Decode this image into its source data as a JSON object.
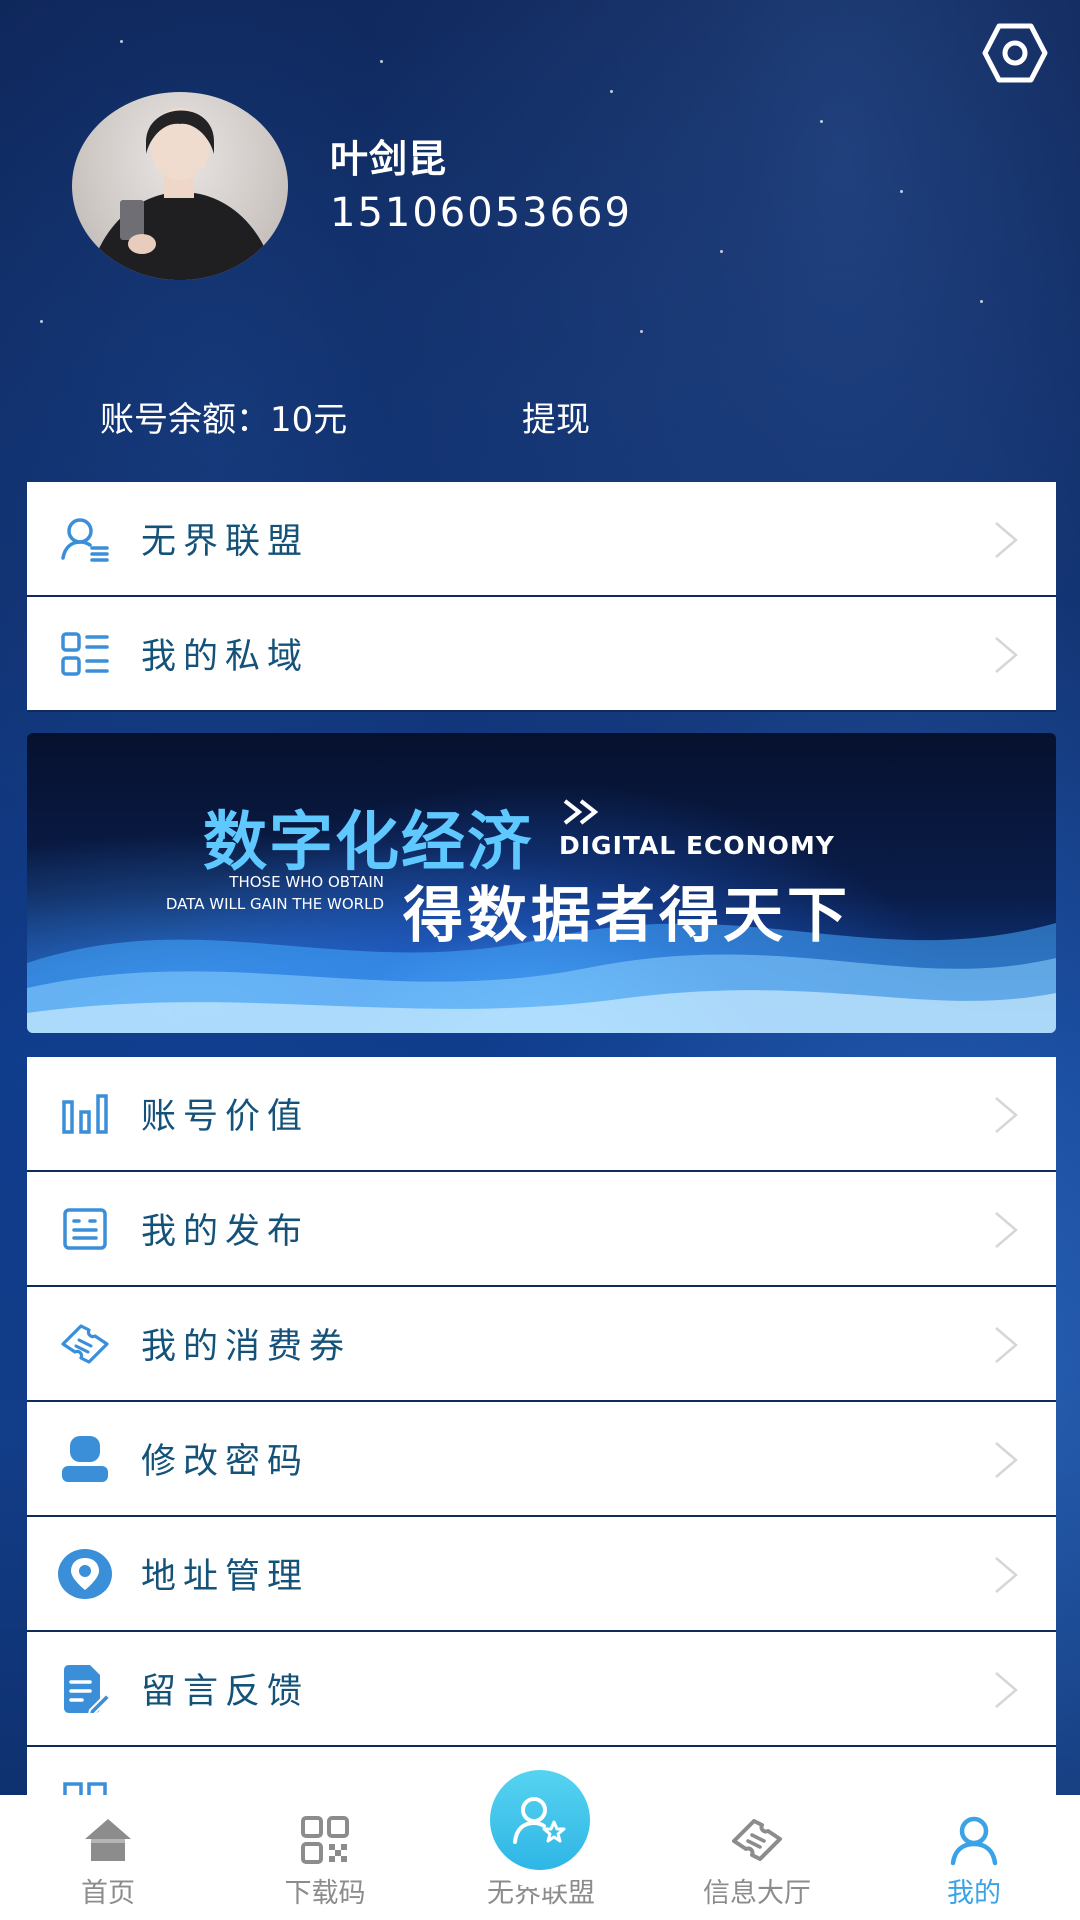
{
  "profile": {
    "name": "叶剑昆",
    "phone": "15106053669",
    "balance_text": "账号余额：10元",
    "withdraw_label": "提现"
  },
  "menu_top": [
    {
      "label": "无界联盟",
      "icon": "user-list-icon"
    },
    {
      "label": "我的私域",
      "icon": "list-grid-icon"
    }
  ],
  "banner": {
    "title_zh": "数字化经济",
    "title_en": "DIGITAL ECONOMY",
    "tagline_en_line1": "THOSE WHO OBTAIN",
    "tagline_en_line2": "DATA WILL GAIN THE WORLD",
    "tagline_zh": "得数据者得天下"
  },
  "menu_main": [
    {
      "label": "账号价值",
      "icon": "bar-chart-icon"
    },
    {
      "label": "我的发布",
      "icon": "document-icon"
    },
    {
      "label": "我的消费券",
      "icon": "ticket-icon"
    },
    {
      "label": "修改密码",
      "icon": "user-icon"
    },
    {
      "label": "地址管理",
      "icon": "location-icon"
    },
    {
      "label": "留言反馈",
      "icon": "feedback-icon"
    }
  ],
  "tabbar": {
    "items": [
      {
        "label": "首页",
        "icon": "home-icon"
      },
      {
        "label": "下载码",
        "icon": "qr-code-icon"
      },
      {
        "label": "无界联盟",
        "icon": "user-star-icon"
      },
      {
        "label": "信息大厅",
        "icon": "ticket-icon"
      },
      {
        "label": "我的",
        "icon": "person-icon"
      }
    ],
    "active_index": 4,
    "active_color": "#3aa3e6",
    "inactive_color": "#8c8c8c"
  },
  "colors": {
    "menu_text": "#15527a",
    "menu_icon": "#3a8fd8",
    "background": "#0c2a66"
  }
}
